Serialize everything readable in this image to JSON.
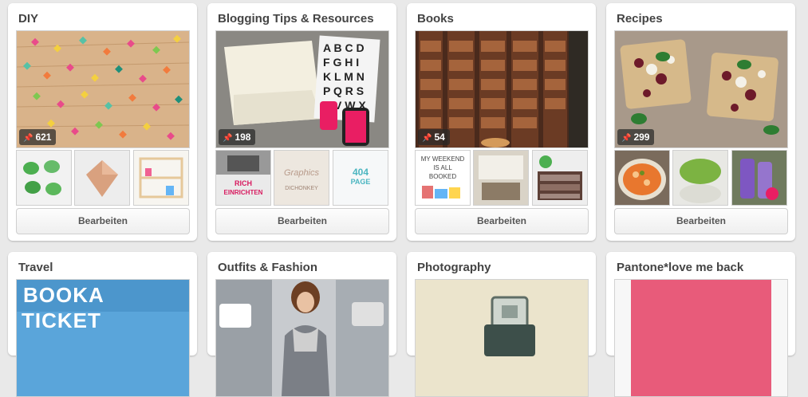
{
  "boards": [
    {
      "title": "DIY",
      "pin_count": "621",
      "edit_label": "Bearbeiten"
    },
    {
      "title": "Blogging Tips & Resources",
      "pin_count": "198",
      "edit_label": "Bearbeiten",
      "thumb_texts": {
        "t0_line1": "RICH",
        "t0_line2": "EINRICHTEN",
        "t1_line1": "Graphics",
        "t1_line2": "DICHONKEY",
        "t2_line1": "404",
        "t2_line2": "PAGE"
      }
    },
    {
      "title": "Books",
      "pin_count": "54",
      "edit_label": "Bearbeiten",
      "thumb_texts": {
        "t0_line1": "MY WEEKEND",
        "t0_line2": "IS ALL",
        "t0_line3": "BOOKED"
      }
    },
    {
      "title": "Recipes",
      "pin_count": "299",
      "edit_label": "Bearbeiten"
    },
    {
      "title": "Travel",
      "cover_text_1": "BOOKA",
      "cover_text_2": "TICKET"
    },
    {
      "title": "Outfits & Fashion"
    },
    {
      "title": "Photography"
    },
    {
      "title": "Pantone*love me back"
    }
  ],
  "colors": {
    "page_bg": "#e9e9e9",
    "pantone_pink": "#e85b7a",
    "travel_sky": "#4f9fd5"
  },
  "icons": {
    "pin": "pushpin-icon"
  }
}
